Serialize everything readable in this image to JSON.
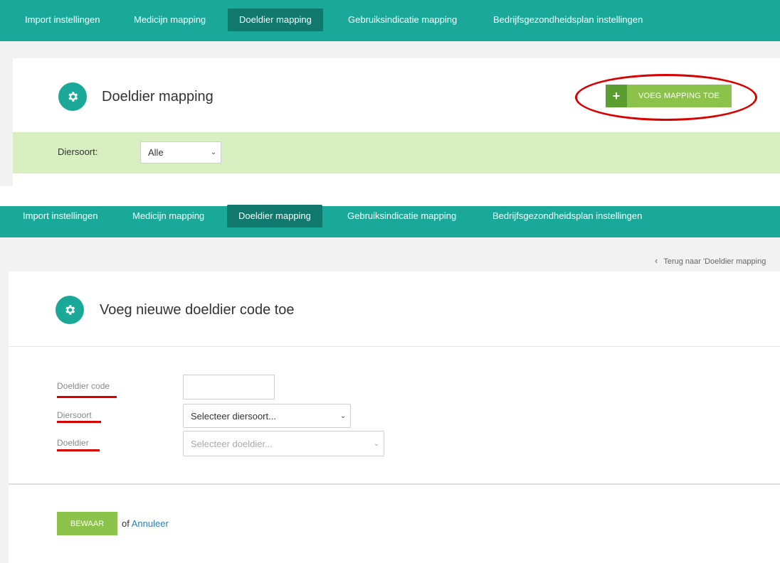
{
  "colors": {
    "teal": "#1aa998",
    "teal_dark": "#10786c",
    "green": "#8bc34a",
    "green_dark": "#5a9e2f",
    "filter_bg": "#d8efc2",
    "highlight": "#d90000",
    "link": "#2a7fb8"
  },
  "nav": {
    "items": [
      "Import instellingen",
      "Medicijn mapping",
      "Doeldier mapping",
      "Gebruiksindicatie mapping",
      "Bedrijfsgezondheidsplan instellingen"
    ],
    "active": "Doeldier mapping"
  },
  "top_panel": {
    "icon": "gear-icon",
    "title": "Doeldier mapping",
    "add_button": {
      "icon": "plus-icon",
      "label": "VOEG MAPPING TOE"
    },
    "filter": {
      "label": "Diersoort:",
      "value": "Alle"
    }
  },
  "bottom_panel": {
    "back_link": "Terug naar 'Doeldier mapping",
    "icon": "gear-icon",
    "title": "Voeg nieuwe doeldier code toe",
    "fields": {
      "code": {
        "label": "Doeldier code",
        "value": ""
      },
      "diersoort": {
        "label": "Diersoort",
        "value": "Selecteer diersoort..."
      },
      "doeldier": {
        "label": "Doeldier",
        "value": "Selecteer doeldier..."
      }
    },
    "save_label": "BEWAAR",
    "or_text": "of",
    "cancel_label": "Annuleer"
  }
}
